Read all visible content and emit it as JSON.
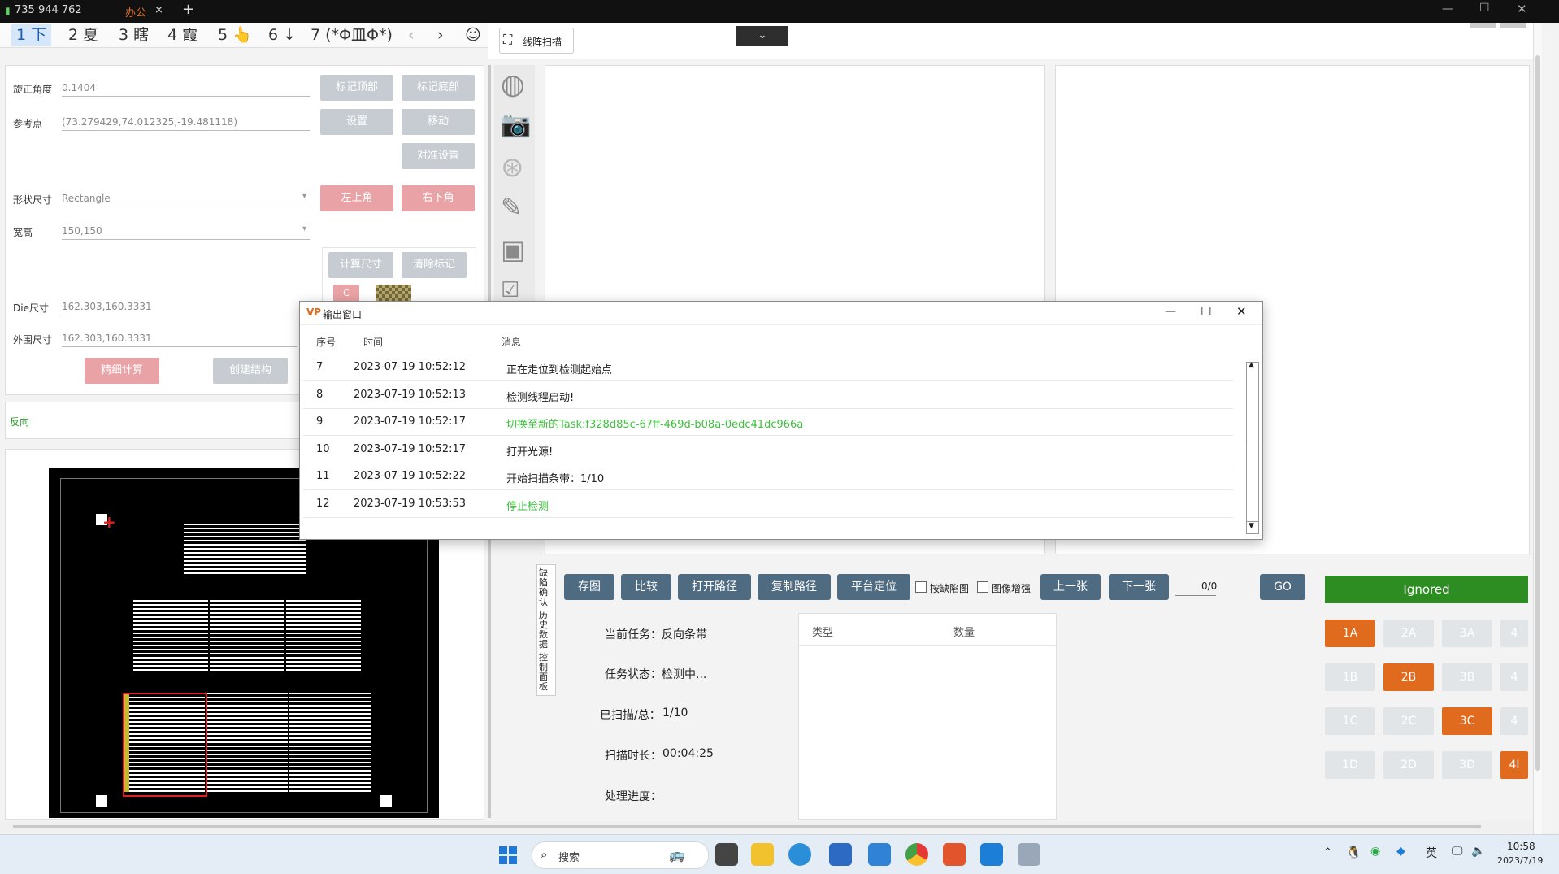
{
  "top_bar": {
    "signal_text": "735 944 762",
    "tab_label": "办公",
    "tab_close": "×",
    "new_tab": "+"
  },
  "ime": {
    "candidates": [
      "1 下",
      "2 夏",
      "3 瞎",
      "4 霞",
      "5 👆",
      "6 ↓",
      "7 (*Φ皿Φ*)"
    ],
    "prev": "‹",
    "next": "›",
    "emoji": "☺"
  },
  "toolbar": {
    "scan_mode_label": "线阵扫描",
    "dropdown_icon": "chevron-down-icon"
  },
  "settings": {
    "rotation_label": "旋正角度",
    "rotation_value": "0.1404",
    "ref_point_label": "参考点",
    "ref_point_value": "(73.279429,74.012325,-19.481118)",
    "shape_label": "形状尺寸",
    "shape_value": "Rectangle",
    "wh_label": "宽高",
    "wh_value": "150,150",
    "die_label": "Die尺寸",
    "die_value": "162.303,160.3331",
    "outer_label": "外围尺寸",
    "outer_value": "162.303,160.3331",
    "btn_mark_top": "标记顶部",
    "btn_mark_bottom": "标记底部",
    "btn_set": "设置",
    "btn_move": "移动",
    "btn_align": "对准设置",
    "btn_top_left": "左上角",
    "btn_bottom_right": "右下角",
    "btn_calc_size": "计算尺寸",
    "btn_clear_mark": "清除标记",
    "btn_c": "C",
    "btn_fine_calc": "精细计算",
    "btn_create_struct": "创建结构"
  },
  "direction_label": "反向",
  "dialog": {
    "title": "输出窗口",
    "col_no": "序号",
    "col_time": "时间",
    "col_msg": "消息",
    "rows": [
      {
        "no": "7",
        "time": "2023-07-19 10:52:12",
        "msg": "正在走位到检测起始点",
        "color": "#222222"
      },
      {
        "no": "8",
        "time": "2023-07-19 10:52:13",
        "msg": "检测线程启动!",
        "color": "#222222"
      },
      {
        "no": "9",
        "time": "2023-07-19 10:52:17",
        "msg": "切换至新的Task:f328d85c-67ff-469d-b08a-0edc41dc966a",
        "color": "#3cc13c"
      },
      {
        "no": "10",
        "time": "2023-07-19 10:52:17",
        "msg": "打开光源!",
        "color": "#222222"
      },
      {
        "no": "11",
        "time": "2023-07-19 10:52:22",
        "msg": " 开始扫描条带：1/10",
        "color": "#222222"
      },
      {
        "no": "12",
        "time": "2023-07-19 10:53:53",
        "msg": "停止检测",
        "color": "#3cc13c"
      }
    ]
  },
  "bottom": {
    "side_tabs": [
      "缺陷确认",
      "历史数据",
      "控制面板"
    ],
    "btn_save": "存图",
    "btn_compare": "比较",
    "btn_open_path": "打开路径",
    "btn_copy_path": "复制路径",
    "btn_platform": "平台定位",
    "chk_defect": "按缺陷图",
    "chk_enhance": "图像增强",
    "btn_prev": "上一张",
    "btn_next": "下一张",
    "page_count": "0/0",
    "btn_go": "GO",
    "ignored_label": "Ignored",
    "task_label": "当前任务：",
    "task_value": "反向条带",
    "state_label": "任务状态：",
    "state_value": "检测中...",
    "scanned_label": "已扫描/总：",
    "scanned_value": "1/10",
    "duration_label": "扫描时长：",
    "duration_value": "00:04:25",
    "progress_label": "处理进度：",
    "table_col_type": "类型",
    "table_col_count": "数量",
    "grades": [
      [
        "1A",
        "2A",
        "3A",
        "4"
      ],
      [
        "1B",
        "2B",
        "3B",
        "4"
      ],
      [
        "1C",
        "2C",
        "3C",
        "4"
      ],
      [
        "1D",
        "2D",
        "3D",
        "4I"
      ]
    ],
    "grades_active": [
      "1A",
      "2B",
      "3C",
      "4I"
    ]
  },
  "taskbar": {
    "search_placeholder": "搜索",
    "ime_lang": "英",
    "time": "10:58",
    "date": "2023/7/19"
  }
}
